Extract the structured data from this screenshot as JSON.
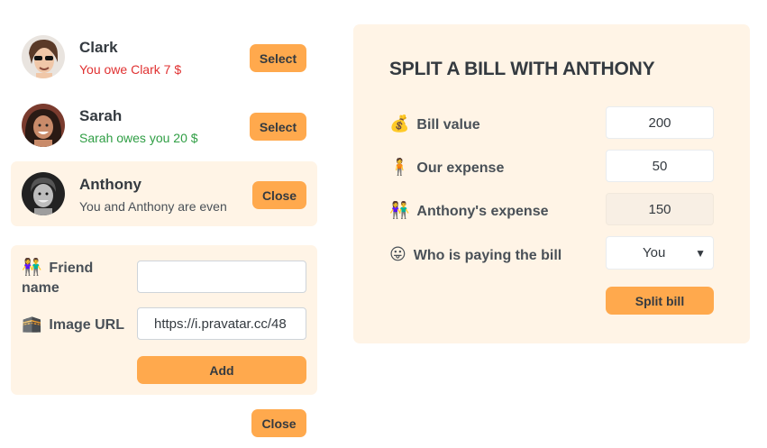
{
  "friends": [
    {
      "name": "Clark",
      "status": "You owe Clark 7 $",
      "button": "Select"
    },
    {
      "name": "Sarah",
      "status": "Sarah owes you 20 $",
      "button": "Select"
    },
    {
      "name": "Anthony",
      "status": "You and Anthony are even",
      "button": "Close"
    }
  ],
  "add_form": {
    "name_label_line1": "Friend",
    "name_label_line2": "name",
    "name_value": "",
    "image_label": "Image URL",
    "image_value": "https://i.pravatar.cc/48",
    "add_button": "Add"
  },
  "close_button": "Close",
  "split": {
    "title": "SPLIT A BILL WITH ANTHONY",
    "bill_label": "Bill value",
    "bill_value": "200",
    "our_label": "Our expense",
    "our_value": "50",
    "friend_label": "Anthony's expense",
    "friend_value": "150",
    "payer_label": "Who is paying the bill",
    "payer_value": "You",
    "split_button": "Split bill"
  },
  "icons": {
    "bill": "money-bag-icon",
    "our": "person-icon",
    "friend": "couple-icon",
    "payer": "tongue-face-icon",
    "friend_name": "couple-icon",
    "image": "kaaba-icon"
  },
  "colors": {
    "accent": "#ffa94d",
    "panel": "#fff4e6",
    "red": "#e03131",
    "green": "#2f9e44"
  }
}
